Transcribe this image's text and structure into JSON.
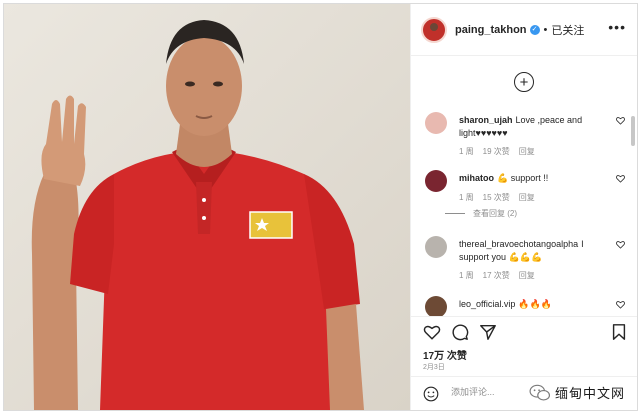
{
  "post": {
    "image_alt": "man in red polo shirt raising three-finger salute",
    "author": "paing_takhon",
    "separator": "•",
    "follow_status": "已关注",
    "more": "•••",
    "load_more": "+"
  },
  "comments": [
    {
      "user": "sharon_ujah",
      "text": "Love ,peace and light♥♥♥♥♥♥",
      "time": "1 周",
      "likes": "19 次赞",
      "reply": "回复",
      "avatar_color": "#e8b9b0"
    },
    {
      "user": "mihatoo",
      "text": "💪 support !!",
      "time": "1 周",
      "likes": "15 次赞",
      "reply": "回复",
      "avatar_color": "#7a2530",
      "view_replies": "查看回复 (2)"
    },
    {
      "user": "thereal_bravoechotangoalpha",
      "text": "I support you 💪💪💪",
      "time": "1 周",
      "likes": "17 次赞",
      "reply": "回复",
      "avatar_color": "#b8b3ad"
    },
    {
      "user": "leo_official.vip",
      "text": "🔥🔥🔥",
      "avatar_color": "#6d4a35"
    }
  ],
  "stats": {
    "likes": "17万 次赞",
    "date": "2月3日"
  },
  "comment_box": {
    "placeholder": "添加评论..."
  },
  "watermark": {
    "text": "缅甸中文网"
  },
  "colors": {
    "shirt_red": "#d42a2a",
    "verified_blue": "#3897f0",
    "heart_red": "#e0245e",
    "muted": "#8e8e8e"
  },
  "icons": [
    "verified-icon",
    "more-icon",
    "load-more-icon",
    "heart-icon",
    "comment-icon",
    "share-icon",
    "save-icon",
    "emoji-icon",
    "wechat-logo-icon"
  ]
}
